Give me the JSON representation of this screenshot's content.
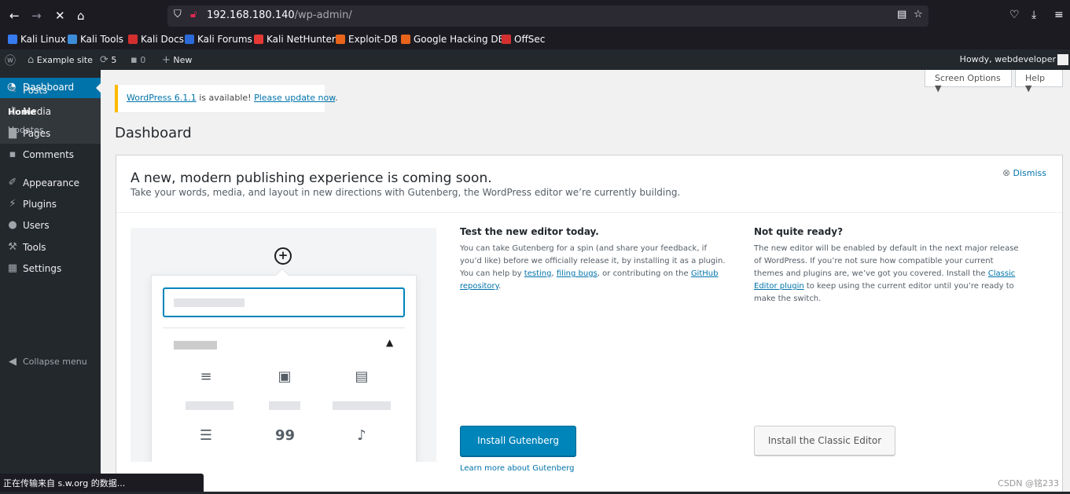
{
  "browser": {
    "url_host": "192.168.180.140",
    "url_path": "/wp-admin/",
    "bookmarks": [
      "Kali Linux",
      "Kali Tools",
      "Kali Docs",
      "Kali Forums",
      "Kali NetHunter",
      "Exploit-DB",
      "Google Hacking DB",
      "OffSec"
    ],
    "bookmark_colors": [
      "#367bf0",
      "#3c8cd8",
      "#d32f2f",
      "#2b6ad8",
      "#e53935",
      "#e8641a",
      "#e8641a",
      "#d32f2f"
    ],
    "status_text": "正在传输来自 s.w.org 的数据..."
  },
  "adminbar": {
    "site_name": "Example site",
    "updates_count": "5",
    "comments_count": "0",
    "new_label": "New",
    "howdy": "Howdy, webdeveloper"
  },
  "sidebar": {
    "current": "Dashboard",
    "submenu": [
      "Home",
      "Updates"
    ],
    "items": [
      {
        "label": "Posts",
        "icon": "pushpin-icon"
      },
      {
        "label": "Media",
        "icon": "media-icon"
      },
      {
        "label": "Pages",
        "icon": "pages-icon"
      },
      {
        "label": "Comments",
        "icon": "comments-icon"
      },
      {
        "label": "Appearance",
        "icon": "brush-icon"
      },
      {
        "label": "Plugins",
        "icon": "plug-icon"
      },
      {
        "label": "Users",
        "icon": "users-icon"
      },
      {
        "label": "Tools",
        "icon": "wrench-icon"
      },
      {
        "label": "Settings",
        "icon": "settings-icon"
      }
    ],
    "collapse": "Collapse menu"
  },
  "screen_options": "Screen Options",
  "help": "Help",
  "notice": {
    "version_link": "WordPress 6.1.1",
    "middle": " is available! ",
    "update_link": "Please update now",
    "end": "."
  },
  "page_title": "Dashboard",
  "panel": {
    "heading": "A new, modern publishing experience is coming soon.",
    "subheading": "Take your words, media, and layout in new directions with Gutenberg, the WordPress editor we’re currently building.",
    "dismiss": "Dismiss",
    "col1": {
      "title": "Test the new editor today.",
      "text_1": "You can take Gutenberg for a spin (and share your feedback, if you’d like) before we officially release it, by installing it as a plugin. You can help by ",
      "link_testing": "testing",
      "sep_1": ", ",
      "link_filing": "filing bugs",
      "text_2": ", or contributing on the ",
      "link_github": "GitHub repository",
      "text_3": ".",
      "button": "Install Gutenberg",
      "learn_more": "Learn more about Gutenberg"
    },
    "col2": {
      "title": "Not quite ready?",
      "text_1": "The new editor will be enabled by default in the next major release of WordPress. If you’re not sure how compatible your current themes and plugins are, we’ve got you covered. Install the ",
      "link_classic": "Classic Editor plugin",
      "text_2": " to keep using the current editor until you’re ready to make the switch.",
      "button": "Install the Classic Editor"
    }
  },
  "watermark": "CSDN @铭233",
  "colors": {
    "accent": "#0073aa",
    "sidebar": "#23282d",
    "notice_border": "#ffb900",
    "primary_button": "#0085ba"
  }
}
